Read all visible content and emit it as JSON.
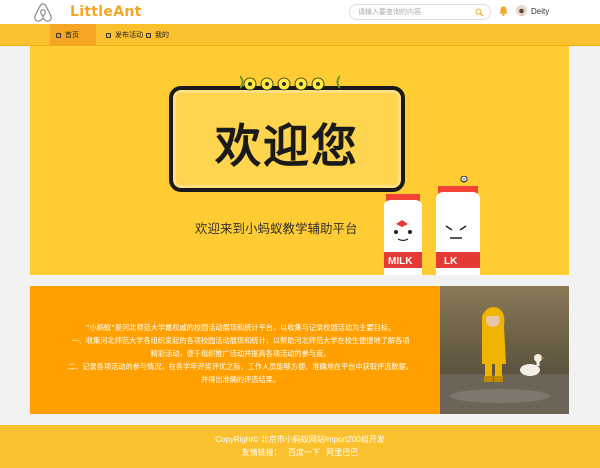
{
  "header": {
    "brand": "LittleAnt",
    "search_placeholder": "请输入要查询的内容",
    "username": "Deity",
    "icons": {
      "logo": "airbnb-logo-icon",
      "search": "search-icon",
      "notify": "bell-icon",
      "avatar": "avatar"
    }
  },
  "nav": {
    "items": [
      {
        "label": "首页",
        "active": true
      },
      {
        "label": "发布活动",
        "active": false
      },
      {
        "label": "我的",
        "active": false
      }
    ]
  },
  "banner": {
    "welcome": "欢迎您",
    "subtitle": "欢迎来到小蚂蚁教学辅助平台",
    "milk_labels": [
      "MILK",
      "LK"
    ]
  },
  "info": {
    "lines": [
      "“小蚂蚁”是河北师范大学最权威的校园活动展现和统计平台，以收集与记录校园活动为主要目标。",
      "一、收集河北师范大学各组织发起的各项校园活动展现和统计，以帮助河北师范大学在校生便捷地了解各项",
      "精彩活动，便于组织推广活动并提高各项活动的参与度。",
      "二、记录各项活动的参与情况，在各学年评奖评优之际，工作人员能够方便、准确地在平台中获取评选数据，",
      "并得出准确的评选结果。"
    ]
  },
  "footer": {
    "copyright": "CopyRight© 北京市小蚂蚁网站Import200组开发",
    "links": [
      "友情链接：",
      "百度一下",
      "阿里巴巴"
    ]
  },
  "colors": {
    "primary": "#fbc02d",
    "accent": "#f5a623",
    "info_bg": "#ffa000"
  }
}
